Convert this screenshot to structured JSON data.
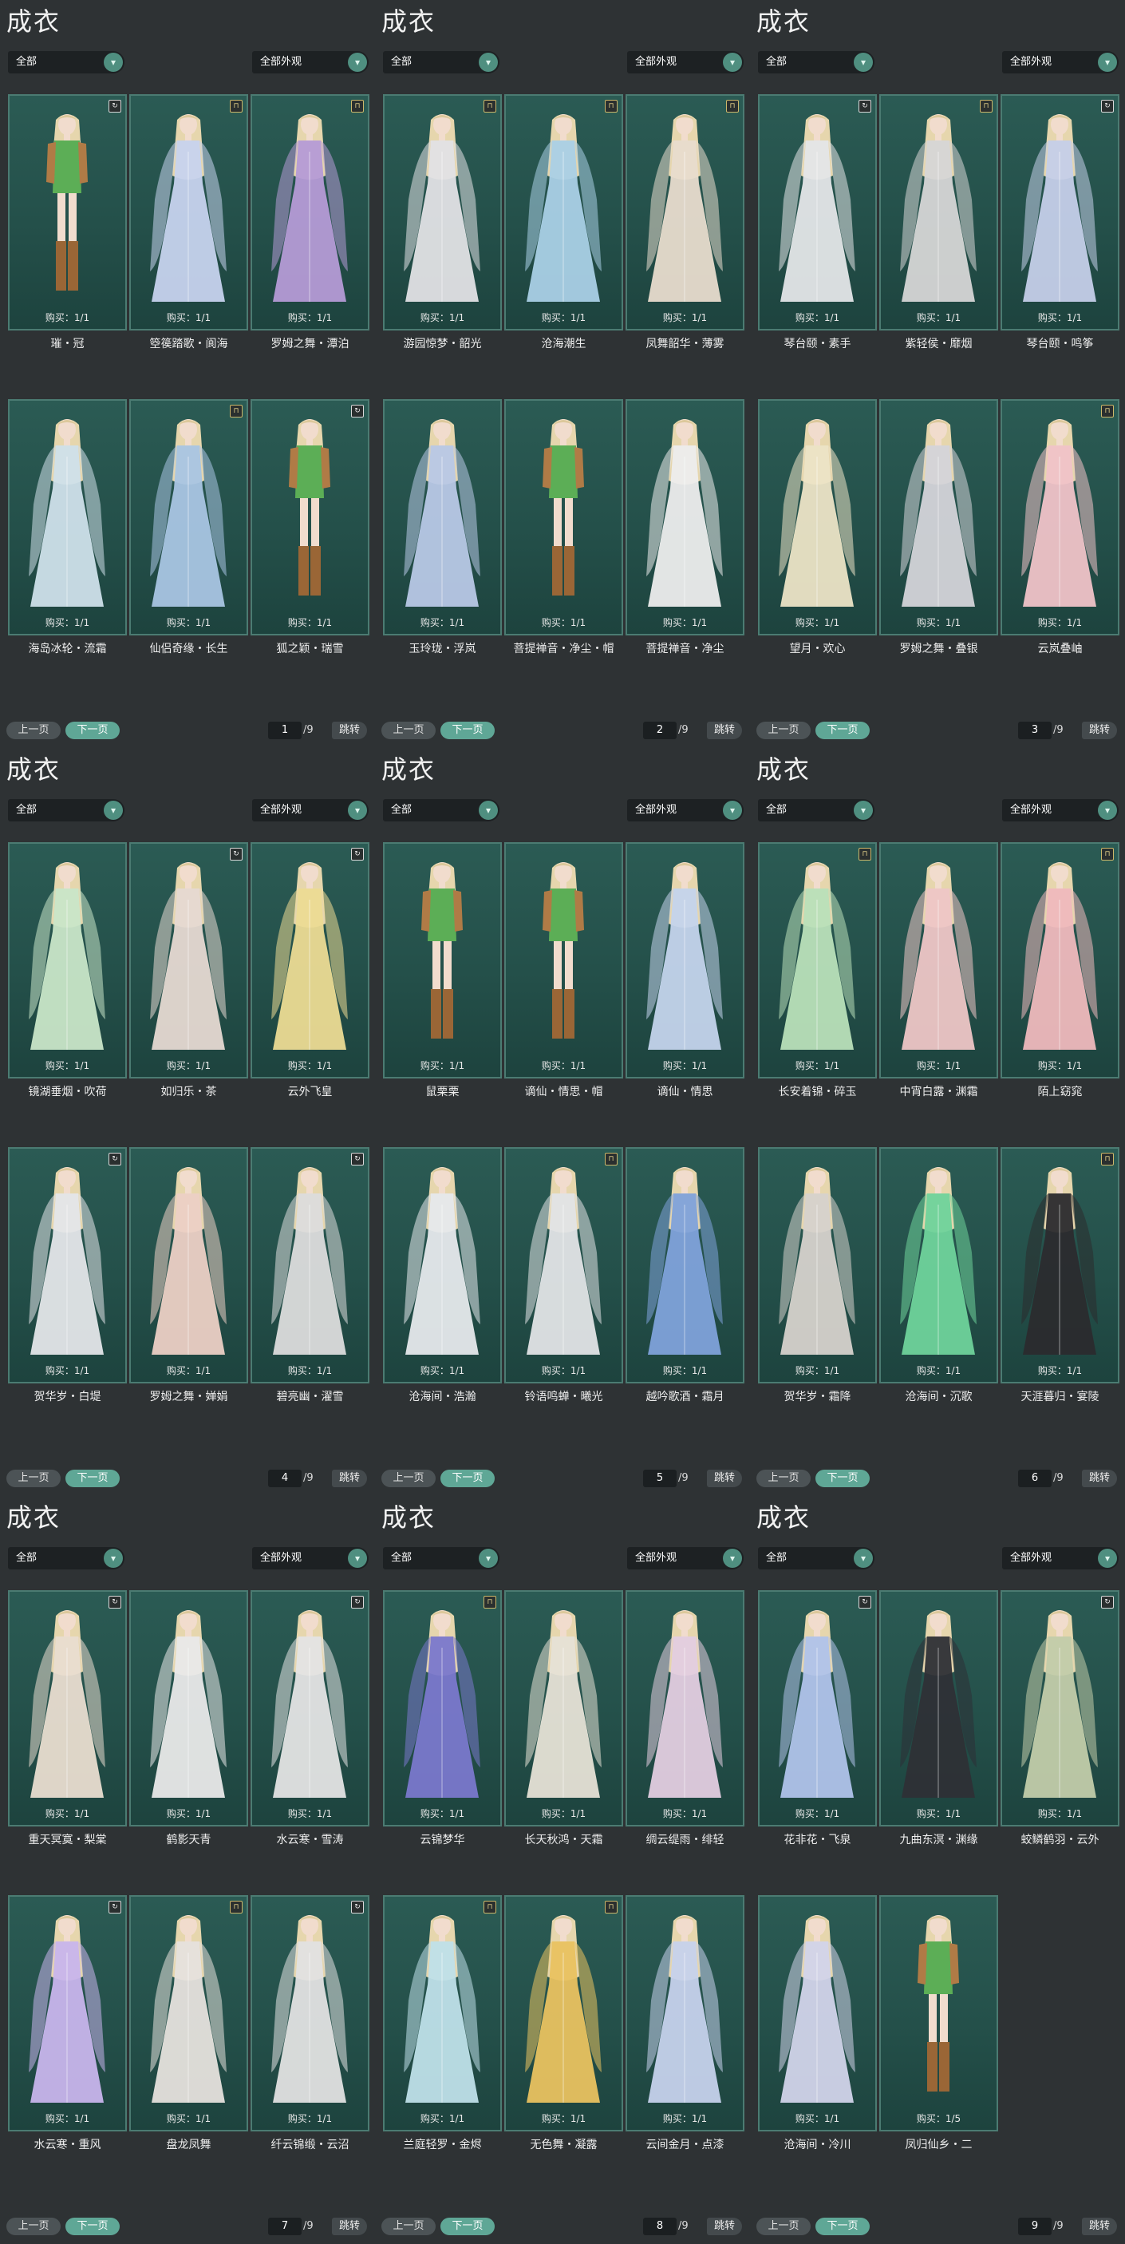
{
  "colors": {
    "background": "#2e3234",
    "card": "#285750",
    "accent": "#5fa796",
    "dropdown": "#1d2123"
  },
  "icons": {
    "arrow": "chevron-down-icon",
    "badge_shop": "shop-bag-icon",
    "badge_cycle": "cycle-icon"
  },
  "panels": [
    {
      "title": "成衣",
      "filter1": "全部",
      "filter2": "全部外观",
      "page": "1",
      "total": "/9",
      "prev": "上一页",
      "next": "下一页",
      "jump": "跳转",
      "cards": [
        {
          "name": "璀・冠",
          "buy": "购买：1/1",
          "dress": "#5cae56",
          "legs": true,
          "badge": "cycle"
        },
        {
          "name": "箜篌踏歌・阆海",
          "buy": "购买：1/1",
          "dress": "#c7d3ee",
          "badge": "shop"
        },
        {
          "name": "罗姆之舞・潭泊",
          "buy": "购买：1/1",
          "dress": "#b59bd6",
          "badge": "shop"
        },
        {
          "name": "海岛冰轮・流霜",
          "buy": "购买：1/1",
          "dress": "#cfe0ea"
        },
        {
          "name": "仙侣奇缘・长生",
          "buy": "购买：1/1",
          "dress": "#a9c5e3",
          "badge": "shop"
        },
        {
          "name": "狐之颖・瑞雪",
          "buy": "购买：1/1",
          "dress": "#5cae56",
          "legs": true,
          "badge": "cycle"
        }
      ]
    },
    {
      "title": "成衣",
      "filter1": "全部",
      "filter2": "全部外观",
      "page": "2",
      "total": "/9",
      "prev": "上一页",
      "next": "下一页",
      "jump": "跳转",
      "cards": [
        {
          "name": "游园惊梦・韶光",
          "buy": "购买：1/1",
          "dress": "#e2e2e5",
          "badge": "shop"
        },
        {
          "name": "沧海潮生",
          "buy": "购买：1/1",
          "dress": "#aad0e6",
          "badge": "shop"
        },
        {
          "name": "凤舞韶华・薄雾",
          "buy": "购买：1/1",
          "dress": "#e8dccd",
          "badge": "shop"
        },
        {
          "name": "玉玲珑・浮岚",
          "buy": "购买：1/1",
          "dress": "#b8c8e6"
        },
        {
          "name": "菩提禅音・净尘・帽",
          "buy": "购买：1/1",
          "dress": "#5cae56",
          "legs": true
        },
        {
          "name": "菩提禅音・净尘",
          "buy": "购买：1/1",
          "dress": "#ededed"
        }
      ]
    },
    {
      "title": "成衣",
      "filter1": "全部",
      "filter2": "全部外观",
      "page": "3",
      "total": "/9",
      "prev": "上一页",
      "next": "下一页",
      "jump": "跳转",
      "cards": [
        {
          "name": "琴台颐・素手",
          "buy": "购买：1/1",
          "dress": "#e4e6e8",
          "badge": "cycle"
        },
        {
          "name": "紫轻侯・靡烟",
          "buy": "购买：1/1",
          "dress": "#d6d6d6",
          "badge": "shop"
        },
        {
          "name": "琴台颐・鸣筝",
          "buy": "购买：1/1",
          "dress": "#c5cfe9",
          "badge": "cycle"
        },
        {
          "name": "望月・欢心",
          "buy": "购买：1/1",
          "dress": "#ece4c6"
        },
        {
          "name": "罗姆之舞・叠银",
          "buy": "购买：1/1",
          "dress": "#d4d4d9"
        },
        {
          "name": "云岚叠岫",
          "buy": "购买：1/1",
          "dress": "#f0c3c8",
          "badge": "shop"
        }
      ]
    },
    {
      "title": "成衣",
      "filter1": "全部",
      "filter2": "全部外观",
      "page": "4",
      "total": "/9",
      "prev": "上一页",
      "next": "下一页",
      "jump": "跳转",
      "cards": [
        {
          "name": "镜湖垂烟・吹荷",
          "buy": "购买：1/1",
          "dress": "#c9e6c8"
        },
        {
          "name": "如归乐・茶",
          "buy": "购买：1/1",
          "dress": "#e6d9d2",
          "badge": "cycle"
        },
        {
          "name": "云外飞皇",
          "buy": "购买：1/1",
          "dress": "#ecdb94",
          "badge": "cycle"
        },
        {
          "name": "贺华岁・白堤",
          "buy": "购买：1/1",
          "dress": "#e4e6e9",
          "badge": "cycle"
        },
        {
          "name": "罗姆之舞・婵娟",
          "buy": "购买：1/1",
          "dress": "#ecd0c5"
        },
        {
          "name": "碧亮幽・濯雪",
          "buy": "购买：1/1",
          "dress": "#dcdcdc",
          "badge": "cycle"
        }
      ]
    },
    {
      "title": "成衣",
      "filter1": "全部",
      "filter2": "全部外观",
      "page": "5",
      "total": "/9",
      "prev": "上一页",
      "next": "下一页",
      "jump": "跳转",
      "cards": [
        {
          "name": "鼠栗栗",
          "buy": "购买：1/1",
          "dress": "#5cae56",
          "legs": true
        },
        {
          "name": "谪仙・情思・帽",
          "buy": "购买：1/1",
          "dress": "#5cae56",
          "legs": true
        },
        {
          "name": "谪仙・情思",
          "buy": "购买：1/1",
          "dress": "#c4d4ec"
        },
        {
          "name": "沧海间・浩瀚",
          "buy": "购买：1/1",
          "dress": "#e6e9ec"
        },
        {
          "name": "铃语鸣蝉・曦光",
          "buy": "购买：1/1",
          "dress": "#e2e4e6",
          "badge": "shop"
        },
        {
          "name": "越吟歌酒・霜月",
          "buy": "购买：1/1",
          "dress": "#7fa2da"
        }
      ]
    },
    {
      "title": "成衣",
      "filter1": "全部",
      "filter2": "全部外观",
      "page": "6",
      "total": "/9",
      "prev": "上一页",
      "next": "下一页",
      "jump": "跳转",
      "cards": [
        {
          "name": "长安着锦・碎玉",
          "buy": "购买：1/1",
          "dress": "#b9e0b9",
          "badge": "shop"
        },
        {
          "name": "中宵白露・渊霜",
          "buy": "购买：1/1",
          "dress": "#eec6c6"
        },
        {
          "name": "陌上窈窕",
          "buy": "购买：1/1",
          "dress": "#efb9bd",
          "badge": "shop"
        },
        {
          "name": "贺华岁・霜降",
          "buy": "购买：1/1",
          "dress": "#d6d2cc"
        },
        {
          "name": "沧海间・沉歌",
          "buy": "购买：1/1",
          "dress": "#6fd39b"
        },
        {
          "name": "天涯暮归・宴陵",
          "buy": "购买：1/1",
          "dress": "#2b2b2e",
          "badge": "shop"
        }
      ]
    },
    {
      "title": "成衣",
      "filter1": "全部",
      "filter2": "全部外观",
      "page": "7",
      "total": "/9",
      "prev": "上一页",
      "next": "下一页",
      "jump": "跳转",
      "cards": [
        {
          "name": "重天冥寞・梨棠",
          "buy": "购买：1/1",
          "dress": "#e9ddd0",
          "badge": "cycle"
        },
        {
          "name": "鹤影天青",
          "buy": "购买：1/1",
          "dress": "#e9e9e9"
        },
        {
          "name": "水云寒・雪涛",
          "buy": "购买：1/1",
          "dress": "#e4e4e4",
          "badge": "cycle"
        },
        {
          "name": "水云寒・重风",
          "buy": "购买：1/1",
          "dress": "#c8b5ec",
          "badge": "cycle"
        },
        {
          "name": "盘龙凤舞",
          "buy": "购买：1/1",
          "dress": "#e6e2dd",
          "badge": "shop"
        },
        {
          "name": "纤云锦缎・云沼",
          "buy": "购买：1/1",
          "dress": "#e2e2e2",
          "badge": "cycle"
        }
      ]
    },
    {
      "title": "成衣",
      "filter1": "全部",
      "filter2": "全部外观",
      "page": "8",
      "total": "/9",
      "prev": "上一页",
      "next": "下一页",
      "jump": "跳转",
      "cards": [
        {
          "name": "云锦梦华",
          "buy": "购买：1/1",
          "dress": "#7a78cc",
          "badge": "shop"
        },
        {
          "name": "长天秋鸿・天霜",
          "buy": "购买：1/1",
          "dress": "#e6e2d6"
        },
        {
          "name": "绸云缇雨・绯轻",
          "buy": "购买：1/1",
          "dress": "#e3cde0"
        },
        {
          "name": "兰庭轻罗・金烬",
          "buy": "购买：1/1",
          "dress": "#bfe0e9",
          "badge": "shop"
        },
        {
          "name": "无色舞・凝露",
          "buy": "购买：1/1",
          "dress": "#e9c260",
          "badge": "shop"
        },
        {
          "name": "云间金月・点漆",
          "buy": "购买：1/1",
          "dress": "#c6d2ec"
        }
      ]
    },
    {
      "title": "成衣",
      "filter1": "全部",
      "filter2": "全部外观",
      "page": "9",
      "total": "/9",
      "prev": "上一页",
      "next": "下一页",
      "jump": "跳转",
      "cards": [
        {
          "name": "花非花・飞泉",
          "buy": "购买：1/1",
          "dress": "#b0c3ea",
          "badge": "cycle"
        },
        {
          "name": "九曲东溟・渊缘",
          "buy": "购买：1/1",
          "dress": "#2e3036"
        },
        {
          "name": "蛟鳞鹤羽・云外",
          "buy": "购买：1/1",
          "dress": "#c2ccaa",
          "badge": "cycle"
        },
        {
          "name": "沧海间・冷川",
          "buy": "购买：1/1",
          "dress": "#d2d4ea"
        },
        {
          "name": "凤归仙乡・二",
          "buy": "购买：1/5",
          "dress": "#5cae56",
          "legs": true
        }
      ]
    }
  ]
}
